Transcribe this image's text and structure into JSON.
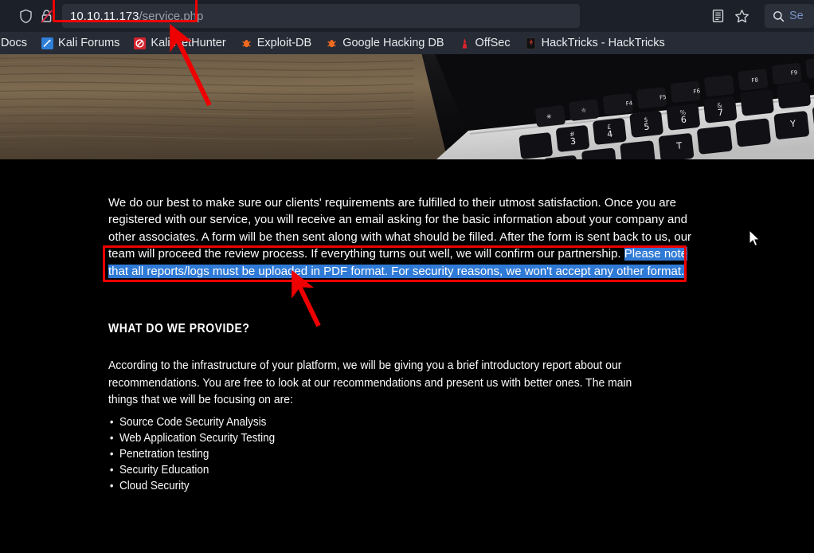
{
  "browser": {
    "url_host": "10.10.11.173",
    "url_path": "/service.php",
    "shield_icon": "shield-icon",
    "lock_icon": "insecure-lock-icon",
    "reader_icon": "reader-view-icon",
    "bookmark_icon": "bookmark-star-icon",
    "search_icon": "search-icon",
    "search_placeholder": "Se"
  },
  "bookmarks": [
    {
      "label": "Docs",
      "icon": "docs-icon"
    },
    {
      "label": "Kali Forums",
      "icon": "kali-forums-icon"
    },
    {
      "label": "Kali NetHunter",
      "icon": "kali-nethunter-icon"
    },
    {
      "label": "Exploit-DB",
      "icon": "exploit-db-icon"
    },
    {
      "label": "Google Hacking DB",
      "icon": "google-hacking-db-icon"
    },
    {
      "label": "OffSec",
      "icon": "offsec-icon"
    },
    {
      "label": "HackTricks - HackTricks",
      "icon": "hacktricks-icon"
    }
  ],
  "page": {
    "paragraph_1_plain": "We do our best to make sure our clients' requirements are fulfilled to their utmost satisfaction. Once you are registered with our service, you will receive an email asking for the basic information about your company and other associates. A form will be then sent along with what should be filled. After the form is sent back to us, our team will proceed the review process. If everything turns out well, we will confirm our partnership. ",
    "paragraph_1_selected": "Please note that all reports/logs must be uploaded in PDF format. For security reasons, we won't accept any other format.",
    "section_heading": "WHAT DO WE PROVIDE?",
    "paragraph_2": "According to the infrastructure of your platform, we will be giving you a brief introductory report about our recommendations. You are free to look at our recommendations and present us with better ones. The main things that we will be focusing on are:",
    "services": [
      "Source Code Security Analysis",
      "Web Application Security Testing",
      "Penetration testing",
      "Security Education",
      "Cloud Security"
    ]
  },
  "annotations": {
    "url_box_color": "#ee0000",
    "text_box_color": "#ee0000",
    "arrow_color": "#ee0000",
    "selection_color": "#2f7ad6"
  }
}
